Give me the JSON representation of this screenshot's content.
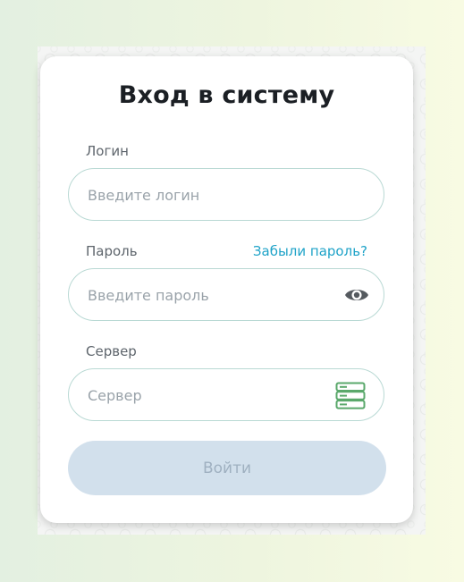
{
  "form": {
    "title": "Вход в систему",
    "login": {
      "label": "Логин",
      "placeholder": "Введите логин",
      "value": ""
    },
    "password": {
      "label": "Пароль",
      "placeholder": "Введите пароль",
      "value": "",
      "forgot_link": "Забыли пароль?"
    },
    "server": {
      "label": "Сервер",
      "placeholder": "Сервер",
      "value": ""
    },
    "submit_label": "Войти"
  },
  "icons": {
    "password_toggle": "eye-icon",
    "server": "server-icon"
  },
  "colors": {
    "link": "#1fa3c8",
    "field_border": "#b9d9d4",
    "server_icon": "#5aa86b",
    "button_disabled_bg": "#d2e0ec",
    "button_disabled_text": "#9fb0c0"
  }
}
